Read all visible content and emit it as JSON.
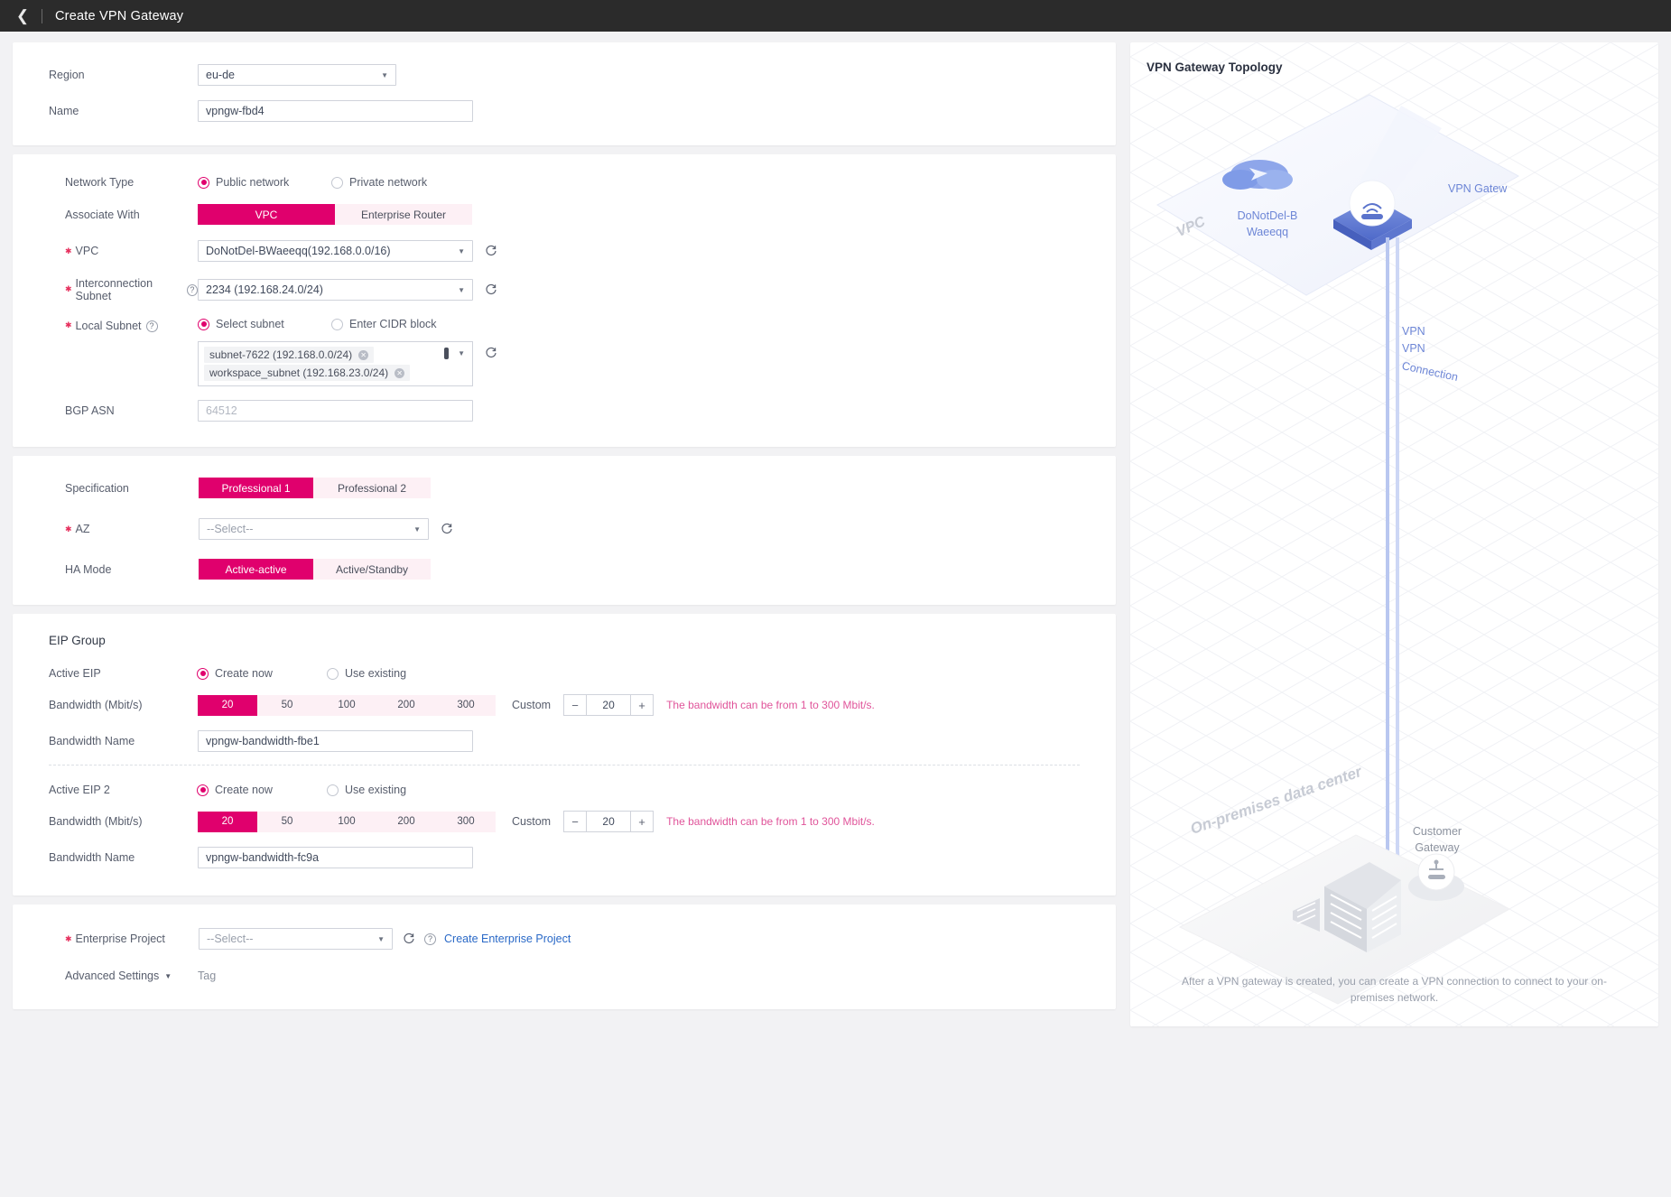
{
  "topbar": {
    "back_icon": "chevron-left-icon",
    "title": "Create VPN Gateway"
  },
  "basic": {
    "region_label": "Region",
    "region_value": "eu-de",
    "name_label": "Name",
    "name_value": "vpngw-fbd4"
  },
  "network": {
    "network_type_label": "Network Type",
    "network_type_options": [
      {
        "label": "Public network",
        "selected": true
      },
      {
        "label": "Private network",
        "selected": false
      }
    ],
    "associate_with_label": "Associate With",
    "associate_with_options": [
      {
        "label": "VPC",
        "selected": true
      },
      {
        "label": "Enterprise Router",
        "selected": false
      }
    ],
    "vpc_label": "VPC",
    "vpc_value": "DoNotDel-BWaeeqq(192.168.0.0/16)",
    "interconnection_subnet_label": "Interconnection Subnet",
    "interconnection_subnet_value": "2234 (192.168.24.0/24)",
    "local_subnet_label": "Local Subnet",
    "local_subnet_options": [
      {
        "label": "Select subnet",
        "selected": true
      },
      {
        "label": "Enter CIDR block",
        "selected": false
      }
    ],
    "local_subnet_tags": [
      "subnet-7622 (192.168.0.0/24)",
      "workspace_subnet (192.168.23.0/24)"
    ],
    "bgp_asn_label": "BGP ASN",
    "bgp_asn_placeholder": "64512"
  },
  "spec": {
    "specification_label": "Specification",
    "specification_options": [
      {
        "label": "Professional 1",
        "selected": true
      },
      {
        "label": "Professional 2",
        "selected": false
      }
    ],
    "az_label": "AZ",
    "az_value": "--Select--",
    "ha_mode_label": "HA Mode",
    "ha_mode_options": [
      {
        "label": "Active-active",
        "selected": true
      },
      {
        "label": "Active/Standby",
        "selected": false
      }
    ]
  },
  "eip_group": {
    "title": "EIP Group",
    "blocks": [
      {
        "eip_label": "Active EIP",
        "eip_options": [
          {
            "label": "Create now",
            "selected": true
          },
          {
            "label": "Use existing",
            "selected": false
          }
        ],
        "bandwidth_label": "Bandwidth (Mbit/s)",
        "bandwidth_presets": [
          "20",
          "50",
          "100",
          "200",
          "300"
        ],
        "bandwidth_selected": "20",
        "custom_label": "Custom",
        "custom_value": "20",
        "hint": "The bandwidth can be from 1 to 300 Mbit/s.",
        "bandwidth_name_label": "Bandwidth Name",
        "bandwidth_name_value": "vpngw-bandwidth-fbe1"
      },
      {
        "eip_label": "Active EIP 2",
        "eip_options": [
          {
            "label": "Create now",
            "selected": true
          },
          {
            "label": "Use existing",
            "selected": false
          }
        ],
        "bandwidth_label": "Bandwidth (Mbit/s)",
        "bandwidth_presets": [
          "20",
          "50",
          "100",
          "200",
          "300"
        ],
        "bandwidth_selected": "20",
        "custom_label": "Custom",
        "custom_value": "20",
        "hint": "The bandwidth can be from 1 to 300 Mbit/s.",
        "bandwidth_name_label": "Bandwidth Name",
        "bandwidth_name_value": "vpngw-bandwidth-fc9a"
      }
    ]
  },
  "footer": {
    "enterprise_project_label": "Enterprise Project",
    "enterprise_project_value": "--Select--",
    "create_enterprise_project_link": "Create Enterprise Project",
    "advanced_settings_label": "Advanced Settings",
    "tag_label": "Tag"
  },
  "topology": {
    "title": "VPN Gateway Topology",
    "vpc_label": "VPC",
    "vpc_name_line1": "DoNotDel-B",
    "vpc_name_line2": "Waeeqq",
    "vpn_gateway_label": "VPN Gatew",
    "connection_line1": "VPN",
    "connection_line2": "VPN",
    "connection_line3": "Connection",
    "onprem_label": "On-premises data center",
    "customer_gw_line1": "Customer",
    "customer_gw_line2": "Gateway",
    "footnote": "After a VPN gateway is created, you can create a VPN connection to connect to your on-premises network."
  },
  "colors": {
    "accent": "#e0006d",
    "accent_soft": "#fdf0f5",
    "topbar": "#2b2b2b",
    "link": "#2a69c7",
    "hint": "#e0549a"
  }
}
